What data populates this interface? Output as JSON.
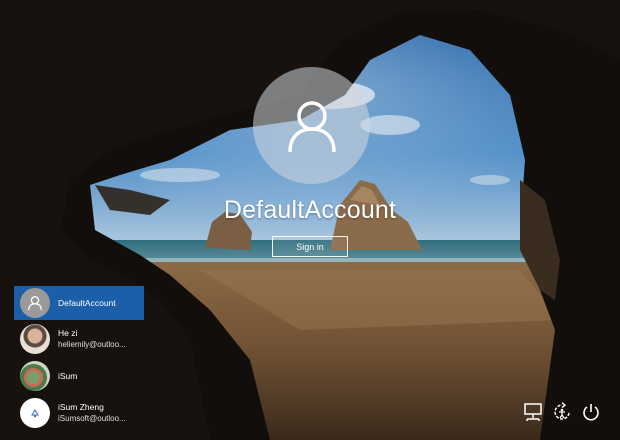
{
  "signin": {
    "username": "DefaultAccount",
    "button_label": "Sign in"
  },
  "users": [
    {
      "name": "DefaultAccount",
      "email": "",
      "selected": true,
      "avatar": "generic-user-icon"
    },
    {
      "name": "He zi",
      "email": "heliemily@outloo...",
      "selected": false,
      "avatar": "user-photo"
    },
    {
      "name": "iSum",
      "email": "",
      "selected": false,
      "avatar": "user-photo"
    },
    {
      "name": "iSum Zheng",
      "email": "iSumsoft@outloo...",
      "selected": false,
      "avatar": "brand-logo"
    }
  ],
  "tray": {
    "icons": [
      "network-icon",
      "ease-of-access-icon",
      "power-icon"
    ]
  },
  "colors": {
    "selected_user_bg": "#1b5fa8",
    "avatar_circle": "#c8ced4"
  }
}
